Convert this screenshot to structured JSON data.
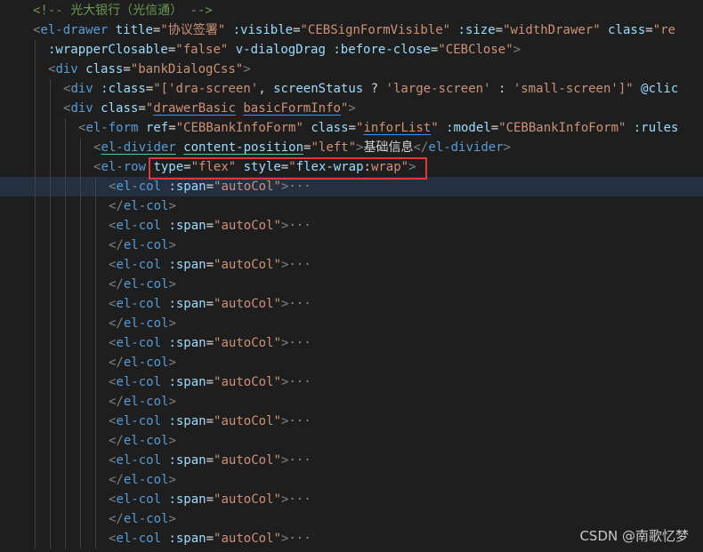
{
  "editor": {
    "lines": [
      {
        "indent": 0,
        "current": false,
        "tokens": [
          {
            "c": "comment",
            "t": "<!-- 光大银行（光信通） -->"
          }
        ]
      },
      {
        "indent": 0,
        "current": false,
        "tokens": [
          {
            "c": "punc",
            "t": "<"
          },
          {
            "c": "tag",
            "t": "el-drawer"
          },
          {
            "c": "text",
            "t": " "
          },
          {
            "c": "attr",
            "t": "title"
          },
          {
            "c": "eq",
            "t": "="
          },
          {
            "c": "str",
            "t": "\"协议签署\""
          },
          {
            "c": "text",
            "t": " "
          },
          {
            "c": "attr",
            "t": ":visible"
          },
          {
            "c": "eq",
            "t": "="
          },
          {
            "c": "str",
            "t": "\"CEBSignFormVisible\""
          },
          {
            "c": "text",
            "t": " "
          },
          {
            "c": "attr",
            "t": ":size"
          },
          {
            "c": "eq",
            "t": "="
          },
          {
            "c": "str",
            "t": "\"widthDrawer\""
          },
          {
            "c": "text",
            "t": " "
          },
          {
            "c": "attr",
            "t": "class"
          },
          {
            "c": "eq",
            "t": "="
          },
          {
            "c": "str",
            "t": "\"re"
          }
        ]
      },
      {
        "indent": 1,
        "current": false,
        "tokens": [
          {
            "c": "attr",
            "t": ":wrapperClosable"
          },
          {
            "c": "eq",
            "t": "="
          },
          {
            "c": "str",
            "t": "\"false\""
          },
          {
            "c": "text",
            "t": " "
          },
          {
            "c": "attr",
            "t": "v-dialogDrag"
          },
          {
            "c": "text",
            "t": " "
          },
          {
            "c": "attr",
            "t": ":before-close"
          },
          {
            "c": "eq",
            "t": "="
          },
          {
            "c": "str",
            "t": "\"CEBClose\""
          },
          {
            "c": "punc",
            "t": ">"
          }
        ]
      },
      {
        "indent": 1,
        "current": false,
        "tokens": [
          {
            "c": "punc",
            "t": "<"
          },
          {
            "c": "tag",
            "t": "div"
          },
          {
            "c": "text",
            "t": " "
          },
          {
            "c": "attr",
            "t": "class"
          },
          {
            "c": "eq",
            "t": "="
          },
          {
            "c": "str",
            "t": "\"bankDialogCss\""
          },
          {
            "c": "punc",
            "t": ">"
          }
        ]
      },
      {
        "indent": 2,
        "current": false,
        "tokens": [
          {
            "c": "punc",
            "t": "<"
          },
          {
            "c": "tag",
            "t": "div"
          },
          {
            "c": "text",
            "t": " "
          },
          {
            "c": "attr",
            "t": ":class"
          },
          {
            "c": "eq",
            "t": "="
          },
          {
            "c": "str",
            "t": "\"["
          },
          {
            "c": "str",
            "t": "'dra-screen'"
          },
          {
            "c": "text",
            "t": ", "
          },
          {
            "c": "attr",
            "t": "screenStatus"
          },
          {
            "c": "text",
            "t": " ? "
          },
          {
            "c": "str",
            "t": "'large-screen'"
          },
          {
            "c": "text",
            "t": " : "
          },
          {
            "c": "str",
            "t": "'small-screen'"
          },
          {
            "c": "str",
            "t": "]\""
          },
          {
            "c": "text",
            "t": " "
          },
          {
            "c": "attr",
            "t": "@clic"
          }
        ]
      },
      {
        "indent": 2,
        "current": false,
        "tokens": [
          {
            "c": "punc",
            "t": "<"
          },
          {
            "c": "tag",
            "t": "div"
          },
          {
            "c": "text",
            "t": " "
          },
          {
            "c": "attr",
            "t": "class"
          },
          {
            "c": "eq",
            "t": "="
          },
          {
            "c": "str",
            "t": "\""
          },
          {
            "c": "str-sq",
            "t": "drawerBasic"
          },
          {
            "c": "str",
            "t": " "
          },
          {
            "c": "str-sq",
            "t": "basicFormInfo"
          },
          {
            "c": "str",
            "t": "\""
          },
          {
            "c": "punc",
            "t": ">"
          }
        ]
      },
      {
        "indent": 3,
        "current": false,
        "tokens": [
          {
            "c": "punc",
            "t": "<"
          },
          {
            "c": "tag",
            "t": "el-form"
          },
          {
            "c": "text",
            "t": " "
          },
          {
            "c": "attr",
            "t": "ref"
          },
          {
            "c": "eq",
            "t": "="
          },
          {
            "c": "str",
            "t": "\"CEBBankInfoForm\""
          },
          {
            "c": "text",
            "t": " "
          },
          {
            "c": "attr",
            "t": "class"
          },
          {
            "c": "eq",
            "t": "="
          },
          {
            "c": "str",
            "t": "\""
          },
          {
            "c": "str-sq",
            "t": "inforList"
          },
          {
            "c": "str",
            "t": "\""
          },
          {
            "c": "text",
            "t": " "
          },
          {
            "c": "attr",
            "t": ":model"
          },
          {
            "c": "eq",
            "t": "="
          },
          {
            "c": "str",
            "t": "\"CEBBankInfoForm\""
          },
          {
            "c": "text",
            "t": " "
          },
          {
            "c": "attr",
            "t": ":rules"
          }
        ]
      },
      {
        "indent": 4,
        "current": false,
        "tokens": [
          {
            "c": "punc",
            "t": "<"
          },
          {
            "c": "tag-sqg",
            "t": "el-divider"
          },
          {
            "c": "text",
            "t": " "
          },
          {
            "c": "attr-sqg",
            "t": "content-position"
          },
          {
            "c": "eq",
            "t": "="
          },
          {
            "c": "str",
            "t": "\"left\""
          },
          {
            "c": "punc",
            "t": ">"
          },
          {
            "c": "text",
            "t": "基础信息"
          },
          {
            "c": "punc",
            "t": "</"
          },
          {
            "c": "tag",
            "t": "el-divider"
          },
          {
            "c": "punc",
            "t": ">"
          }
        ]
      },
      {
        "indent": 4,
        "current": false,
        "tokens": [
          {
            "c": "punc",
            "t": "<"
          },
          {
            "c": "tag",
            "t": "el-row"
          },
          {
            "c": "text",
            "t": " "
          },
          {
            "c": "attr",
            "t": "type"
          },
          {
            "c": "eq",
            "t": "="
          },
          {
            "c": "str",
            "t": "\"flex\""
          },
          {
            "c": "text",
            "t": " "
          },
          {
            "c": "attr",
            "t": "style"
          },
          {
            "c": "eq",
            "t": "="
          },
          {
            "c": "str",
            "t": "\""
          },
          {
            "c": "attr",
            "t": "flex-wrap"
          },
          {
            "c": "text",
            "t": ":"
          },
          {
            "c": "str",
            "t": "wrap\""
          },
          {
            "c": "punc",
            "t": ">"
          }
        ]
      },
      {
        "indent": 5,
        "current": true,
        "tokens": [
          {
            "c": "punc",
            "t": "<"
          },
          {
            "c": "tag",
            "t": "el-col"
          },
          {
            "c": "text",
            "t": " "
          },
          {
            "c": "attr",
            "t": ":span"
          },
          {
            "c": "eq",
            "t": "="
          },
          {
            "c": "str",
            "t": "\"autoCol\""
          },
          {
            "c": "punc",
            "t": ">"
          },
          {
            "c": "fold",
            "t": "···"
          }
        ]
      },
      {
        "indent": 5,
        "current": false,
        "tokens": [
          {
            "c": "punc",
            "t": "</"
          },
          {
            "c": "tag",
            "t": "el-col"
          },
          {
            "c": "punc",
            "t": ">"
          }
        ]
      },
      {
        "indent": 5,
        "current": false,
        "tokens": [
          {
            "c": "punc",
            "t": "<"
          },
          {
            "c": "tag",
            "t": "el-col"
          },
          {
            "c": "text",
            "t": " "
          },
          {
            "c": "attr",
            "t": ":span"
          },
          {
            "c": "eq",
            "t": "="
          },
          {
            "c": "str",
            "t": "\"autoCol\""
          },
          {
            "c": "punc",
            "t": ">"
          },
          {
            "c": "fold",
            "t": "···"
          }
        ]
      },
      {
        "indent": 5,
        "current": false,
        "tokens": [
          {
            "c": "punc",
            "t": "</"
          },
          {
            "c": "tag",
            "t": "el-col"
          },
          {
            "c": "punc",
            "t": ">"
          }
        ]
      },
      {
        "indent": 5,
        "current": false,
        "tokens": [
          {
            "c": "punc",
            "t": "<"
          },
          {
            "c": "tag",
            "t": "el-col"
          },
          {
            "c": "text",
            "t": " "
          },
          {
            "c": "attr",
            "t": ":span"
          },
          {
            "c": "eq",
            "t": "="
          },
          {
            "c": "str",
            "t": "\"autoCol\""
          },
          {
            "c": "punc",
            "t": ">"
          },
          {
            "c": "fold",
            "t": "···"
          }
        ]
      },
      {
        "indent": 5,
        "current": false,
        "tokens": [
          {
            "c": "punc",
            "t": "</"
          },
          {
            "c": "tag",
            "t": "el-col"
          },
          {
            "c": "punc",
            "t": ">"
          }
        ]
      },
      {
        "indent": 5,
        "current": false,
        "tokens": [
          {
            "c": "punc",
            "t": "<"
          },
          {
            "c": "tag",
            "t": "el-col"
          },
          {
            "c": "text",
            "t": " "
          },
          {
            "c": "attr",
            "t": ":span"
          },
          {
            "c": "eq",
            "t": "="
          },
          {
            "c": "str",
            "t": "\"autoCol\""
          },
          {
            "c": "punc",
            "t": ">"
          },
          {
            "c": "fold",
            "t": "···"
          }
        ]
      },
      {
        "indent": 5,
        "current": false,
        "tokens": [
          {
            "c": "punc",
            "t": "</"
          },
          {
            "c": "tag",
            "t": "el-col"
          },
          {
            "c": "punc",
            "t": ">"
          }
        ]
      },
      {
        "indent": 5,
        "current": false,
        "tokens": [
          {
            "c": "punc",
            "t": "<"
          },
          {
            "c": "tag",
            "t": "el-col"
          },
          {
            "c": "text",
            "t": " "
          },
          {
            "c": "attr",
            "t": ":span"
          },
          {
            "c": "eq",
            "t": "="
          },
          {
            "c": "str",
            "t": "\"autoCol\""
          },
          {
            "c": "punc",
            "t": ">"
          },
          {
            "c": "fold",
            "t": "···"
          }
        ]
      },
      {
        "indent": 5,
        "current": false,
        "tokens": [
          {
            "c": "punc",
            "t": "</"
          },
          {
            "c": "tag",
            "t": "el-col"
          },
          {
            "c": "punc",
            "t": ">"
          }
        ]
      },
      {
        "indent": 5,
        "current": false,
        "tokens": [
          {
            "c": "punc",
            "t": "<"
          },
          {
            "c": "tag",
            "t": "el-col"
          },
          {
            "c": "text",
            "t": " "
          },
          {
            "c": "attr",
            "t": ":span"
          },
          {
            "c": "eq",
            "t": "="
          },
          {
            "c": "str",
            "t": "\"autoCol\""
          },
          {
            "c": "punc",
            "t": ">"
          },
          {
            "c": "fold",
            "t": "···"
          }
        ]
      },
      {
        "indent": 5,
        "current": false,
        "tokens": [
          {
            "c": "punc",
            "t": "</"
          },
          {
            "c": "tag",
            "t": "el-col"
          },
          {
            "c": "punc",
            "t": ">"
          }
        ]
      },
      {
        "indent": 5,
        "current": false,
        "tokens": [
          {
            "c": "punc",
            "t": "<"
          },
          {
            "c": "tag",
            "t": "el-col"
          },
          {
            "c": "text",
            "t": " "
          },
          {
            "c": "attr",
            "t": ":span"
          },
          {
            "c": "eq",
            "t": "="
          },
          {
            "c": "str",
            "t": "\"autoCol\""
          },
          {
            "c": "punc",
            "t": ">"
          },
          {
            "c": "fold",
            "t": "···"
          }
        ]
      },
      {
        "indent": 5,
        "current": false,
        "tokens": [
          {
            "c": "punc",
            "t": "</"
          },
          {
            "c": "tag",
            "t": "el-col"
          },
          {
            "c": "punc",
            "t": ">"
          }
        ]
      },
      {
        "indent": 5,
        "current": false,
        "tokens": [
          {
            "c": "punc",
            "t": "<"
          },
          {
            "c": "tag",
            "t": "el-col"
          },
          {
            "c": "text",
            "t": " "
          },
          {
            "c": "attr",
            "t": ":span"
          },
          {
            "c": "eq",
            "t": "="
          },
          {
            "c": "str",
            "t": "\"autoCol\""
          },
          {
            "c": "punc",
            "t": ">"
          },
          {
            "c": "fold",
            "t": "···"
          }
        ]
      },
      {
        "indent": 5,
        "current": false,
        "tokens": [
          {
            "c": "punc",
            "t": "</"
          },
          {
            "c": "tag",
            "t": "el-col"
          },
          {
            "c": "punc",
            "t": ">"
          }
        ]
      },
      {
        "indent": 5,
        "current": false,
        "tokens": [
          {
            "c": "punc",
            "t": "<"
          },
          {
            "c": "tag",
            "t": "el-col"
          },
          {
            "c": "text",
            "t": " "
          },
          {
            "c": "attr",
            "t": ":span"
          },
          {
            "c": "eq",
            "t": "="
          },
          {
            "c": "str",
            "t": "\"autoCol\""
          },
          {
            "c": "punc",
            "t": ">"
          },
          {
            "c": "fold",
            "t": "···"
          }
        ]
      },
      {
        "indent": 5,
        "current": false,
        "tokens": [
          {
            "c": "punc",
            "t": "</"
          },
          {
            "c": "tag",
            "t": "el-col"
          },
          {
            "c": "punc",
            "t": ">"
          }
        ]
      },
      {
        "indent": 5,
        "current": false,
        "tokens": [
          {
            "c": "punc",
            "t": "<"
          },
          {
            "c": "tag",
            "t": "el-col"
          },
          {
            "c": "text",
            "t": " "
          },
          {
            "c": "attr",
            "t": ":span"
          },
          {
            "c": "eq",
            "t": "="
          },
          {
            "c": "str",
            "t": "\"autoCol\""
          },
          {
            "c": "punc",
            "t": ">"
          },
          {
            "c": "fold",
            "t": "···"
          }
        ]
      }
    ]
  },
  "highlight": {
    "label": "annotation highlight on line 9",
    "color": "#e0383a"
  },
  "watermark": {
    "text": "CSDN @南歌忆梦"
  },
  "colors": {
    "background": "#1e1e1e",
    "current_line": "#243040",
    "comment": "#6a9955",
    "tag": "#569cd6",
    "attribute": "#9cdcfe",
    "string": "#ce9178",
    "punctuation": "#808080",
    "text": "#d4d4d4"
  }
}
